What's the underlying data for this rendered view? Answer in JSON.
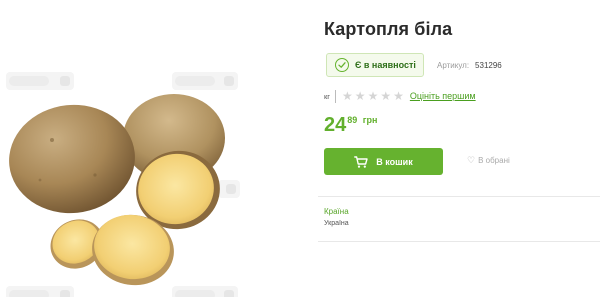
{
  "product": {
    "title": "Картопля біла",
    "availability": "Є в наявності",
    "article_label": "Артикул:",
    "article_value": "531296",
    "unit": "кг",
    "rating": {
      "value": 0,
      "max": 5
    },
    "rate_first_link": "Оцініть першим",
    "price": {
      "main": "24",
      "cents": "89",
      "currency": "грн"
    }
  },
  "actions": {
    "add_to_cart": "В кошик",
    "favorites": "В обрані"
  },
  "specs": {
    "country_label": "Країна",
    "country_value": "Україна"
  },
  "colors": {
    "accent": "#66b22f",
    "accent_dark": "#2e6f19",
    "stock_bg": "#f4faec",
    "rating_empty": "#d5d5d5"
  },
  "icons": {
    "availability": "check-circle-icon",
    "cart": "cart-icon",
    "favorites": "heart-icon",
    "rating": "star-icon"
  }
}
